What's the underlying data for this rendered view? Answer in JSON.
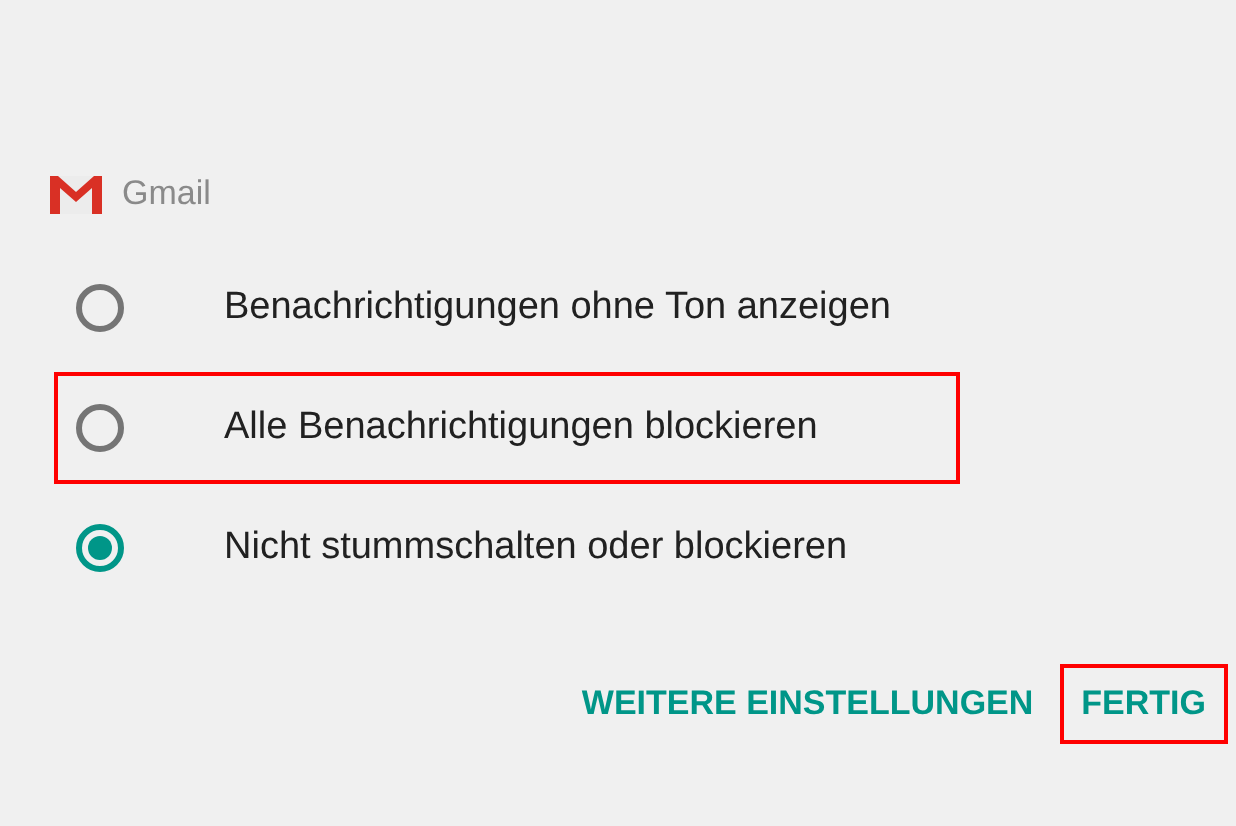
{
  "app": {
    "name": "Gmail"
  },
  "options": [
    {
      "label": "Benachrichtigungen ohne Ton anzeigen",
      "selected": false,
      "highlighted": false
    },
    {
      "label": "Alle Benachrichtigungen blockieren",
      "selected": false,
      "highlighted": true
    },
    {
      "label": "Nicht stummschalten oder blockieren",
      "selected": true,
      "highlighted": false
    }
  ],
  "buttons": [
    {
      "label": "WEITERE EINSTELLUNGEN",
      "highlighted": false
    },
    {
      "label": "FERTIG",
      "highlighted": true
    }
  ]
}
